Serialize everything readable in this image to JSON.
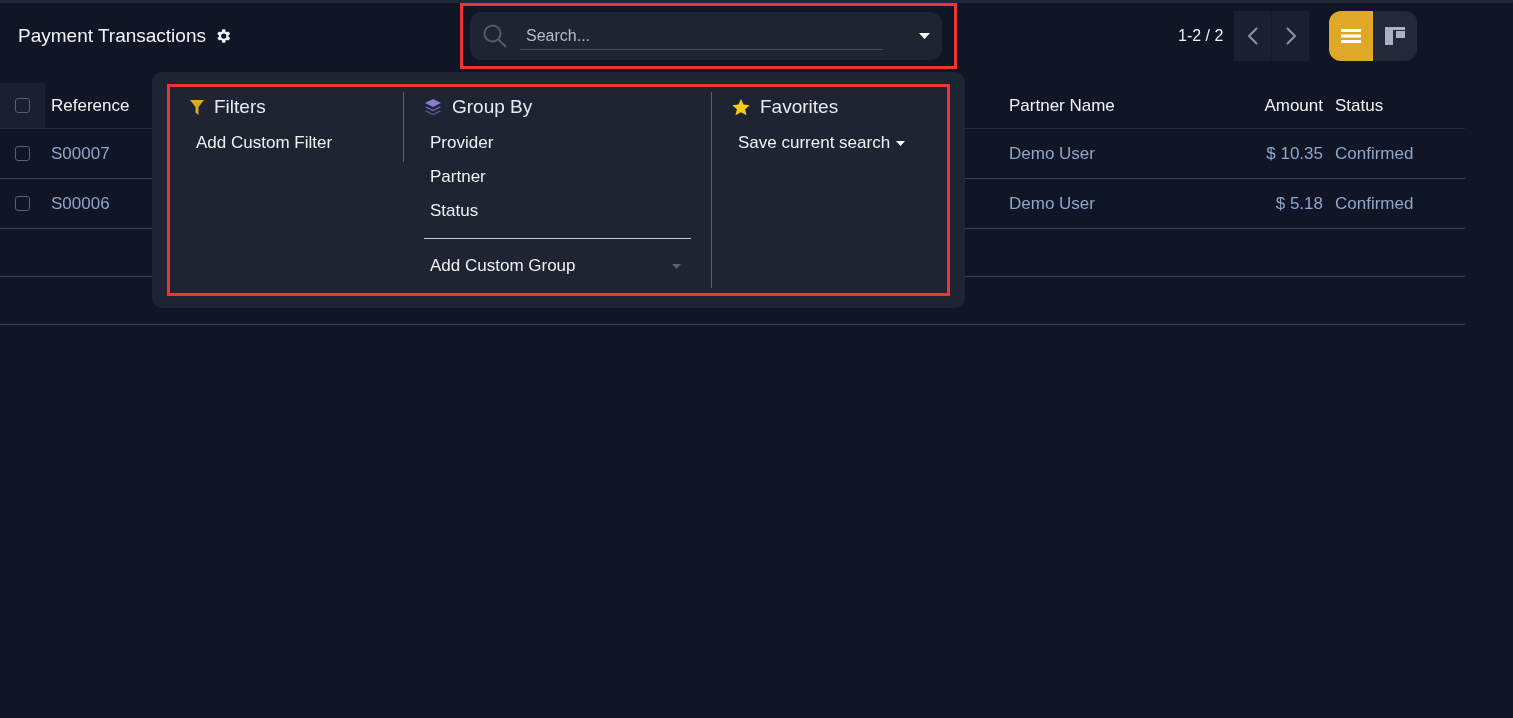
{
  "header": {
    "title": "Payment Transactions",
    "search": {
      "placeholder": "Search..."
    },
    "pager": "1-2 / 2",
    "views": [
      {
        "kind": "list",
        "selected": true
      },
      {
        "kind": "kanban",
        "selected": false
      }
    ]
  },
  "table": {
    "all_checked": false,
    "columns": [
      "Reference",
      "Partner Name",
      "Amount",
      "Status"
    ],
    "rows": [
      {
        "checked": false,
        "reference": "S00007",
        "partner": "Demo User",
        "amount": "$ 10.35",
        "status": "Confirmed"
      },
      {
        "checked": false,
        "reference": "S00006",
        "partner": "Demo User",
        "amount": "$ 5.18",
        "status": "Confirmed"
      }
    ]
  },
  "dropdown": {
    "filters": {
      "title": "Filters",
      "items": [
        "Add Custom Filter"
      ]
    },
    "group_by": {
      "title": "Group By",
      "items": [
        "Provider",
        "Partner",
        "Status"
      ],
      "custom": "Add Custom Group"
    },
    "favorites": {
      "title": "Favorites",
      "items": [
        "Save current search"
      ]
    }
  }
}
